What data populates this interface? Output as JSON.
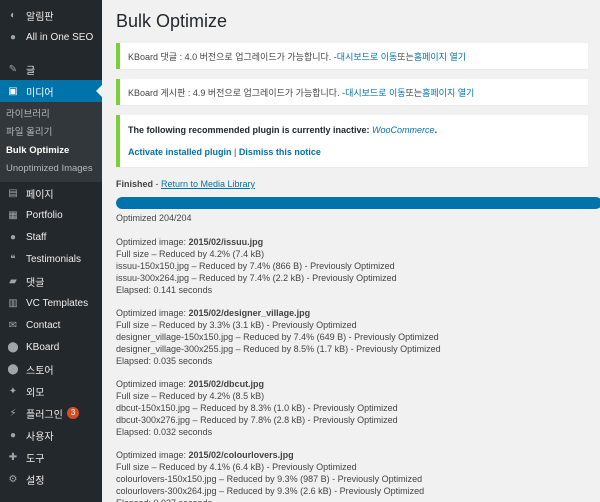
{
  "sidebar": {
    "items_top": [
      {
        "label": "알림판",
        "icon": "dashboard-icon",
        "glyph": "◐"
      },
      {
        "label": "All in One SEO",
        "icon": "seo-icon",
        "glyph": "●"
      }
    ],
    "items_mid": [
      {
        "label": "글",
        "icon": "pushpin-icon",
        "glyph": "✎"
      },
      {
        "label": "미디어",
        "icon": "media-icon",
        "glyph": "▣",
        "active": true
      }
    ],
    "submenu": [
      {
        "label": "라이브러리"
      },
      {
        "label": "파일 올리기"
      },
      {
        "label": "Bulk Optimize",
        "current": true
      },
      {
        "label": "Unoptimized Images"
      }
    ],
    "items_bottom": [
      {
        "label": "페이지",
        "icon": "page-icon",
        "glyph": "▤"
      },
      {
        "label": "Portfolio",
        "icon": "portfolio-icon",
        "glyph": "▦"
      },
      {
        "label": "Staff",
        "icon": "staff-icon",
        "glyph": "●"
      },
      {
        "label": "Testimonials",
        "icon": "testimonials-icon",
        "glyph": "❝"
      },
      {
        "label": "댓글",
        "icon": "comments-icon",
        "glyph": "▰"
      },
      {
        "label": "VC Templates",
        "icon": "templates-icon",
        "glyph": "▥"
      },
      {
        "label": "Contact",
        "icon": "contact-icon",
        "glyph": "✉"
      },
      {
        "label": "KBoard",
        "icon": "kboard-icon",
        "glyph": "⬤"
      },
      {
        "label": "스토어",
        "icon": "store-icon",
        "glyph": "⬤"
      },
      {
        "label": "외모",
        "icon": "appearance-icon",
        "glyph": "✦"
      },
      {
        "label": "플러그인",
        "icon": "plugins-icon",
        "glyph": "⚡",
        "badge": "3"
      },
      {
        "label": "사용자",
        "icon": "users-icon",
        "glyph": "●"
      },
      {
        "label": "도구",
        "icon": "tools-icon",
        "glyph": "✚"
      },
      {
        "label": "설정",
        "icon": "settings-icon",
        "glyph": "⚙"
      }
    ]
  },
  "main": {
    "title": "Bulk Optimize",
    "notice1": {
      "prefix": "KBoard 댓글 : 4.0 버전으로 업그레이드가 가능합니다. - ",
      "link1": "대시보드로 이동",
      "mid": " 또는 ",
      "link2": "홈페이지 열기"
    },
    "notice2": {
      "prefix": "KBoard 게시판 : 4.9 버전으로 업그레이드가 가능합니다. - ",
      "link1": "대시보드로 이동",
      "mid": " 또는 ",
      "link2": "홈페이지 열기"
    },
    "notice3": {
      "text": "The following recommended plugin is currently inactive: ",
      "plugin": "WooCommerce",
      "end": ".",
      "activate": "Activate installed plugin",
      "sep": " | ",
      "dismiss": "Dismiss this notice"
    },
    "finished_label": "Finished",
    "finished_sep": " - ",
    "return_link": "Return to Media Library",
    "progress": {
      "percent": 100
    },
    "optimized_count": "Optimized 204/204",
    "results": [
      {
        "prefix": "Optimized image: ",
        "file": "2015/02/issuu.jpg",
        "lines": [
          "Full size – Reduced by 4.2% (7.4 kB)",
          "issuu-150x150.jpg – Reduced by 7.4% (866 B) - Previously Optimized",
          "issuu-300x264.jpg – Reduced by 7.4% (2.2 kB) - Previously Optimized",
          "Elapsed: 0.141 seconds"
        ]
      },
      {
        "prefix": "Optimized image: ",
        "file": "2015/02/designer_village.jpg",
        "lines": [
          "Full size – Reduced by 3.3% (3.1 kB) - Previously Optimized",
          "designer_village-150x150.jpg – Reduced by 7.4% (649 B) - Previously Optimized",
          "designer_village-300x255.jpg – Reduced by 8.5% (1.7 kB) - Previously Optimized",
          "Elapsed: 0.035 seconds"
        ]
      },
      {
        "prefix": "Optimized image: ",
        "file": "2015/02/dbcut.jpg",
        "lines": [
          "Full size – Reduced by 4.2% (8.5 kB)",
          "dbcut-150x150.jpg – Reduced by 8.3% (1.0 kB) - Previously Optimized",
          "dbcut-300x276.jpg – Reduced by 7.8% (2.8 kB) - Previously Optimized",
          "Elapsed: 0.032 seconds"
        ]
      },
      {
        "prefix": "Optimized image: ",
        "file": "2015/02/colourlovers.jpg",
        "lines": [
          "Full size – Reduced by 4.1% (6.4 kB) - Previously Optimized",
          "colourlovers-150x150.jpg – Reduced by 9.3% (987 B) - Previously Optimized",
          "colourlovers-300x264.jpg – Reduced by 9.3% (2.6 kB) - Previously Optimized",
          "Elapsed: 0.027 seconds"
        ]
      }
    ]
  },
  "colors": {
    "sidebar_bg": "#23282d",
    "accent": "#0073aa",
    "notice_border": "#7ad03a"
  }
}
